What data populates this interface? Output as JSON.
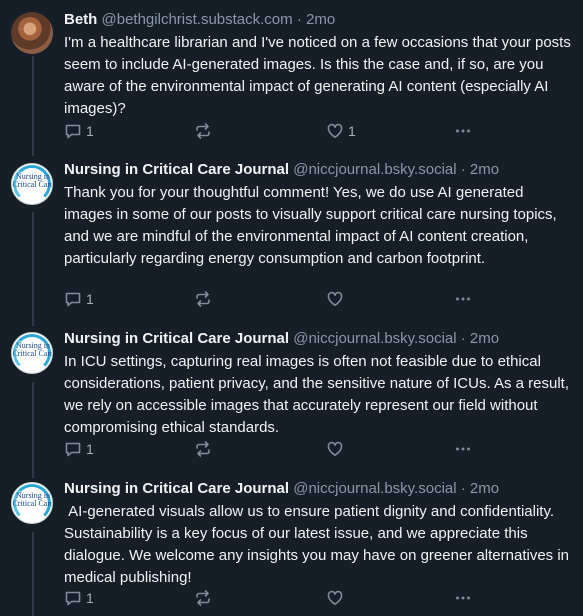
{
  "colors": {
    "background": "#161e27",
    "text": "#f1f3f5",
    "muted": "#8a98a6",
    "rail": "#2e3a47"
  },
  "posts": [
    {
      "author": "Beth",
      "handle": "@bethgilchrist.substack.com",
      "time": "· 2mo",
      "text": "I'm a healthcare librarian and I've noticed on a few occasions that your posts seem to include AI-generated images. Is this the case and, if so, are you aware of the environmental impact of generating AI content (especially AI images)?",
      "replies": "1",
      "likes": "1"
    },
    {
      "author": "Nursing in Critical Care Journal",
      "handle": "@niccjournal.bsky.social",
      "time": "· 2mo",
      "avatar_text": "Nursing in Critical Care",
      "text": "Thank you for your thoughtful comment! Yes, we do use AI generated images in some of our posts to visually support critical care nursing topics, and we are mindful of the environmental impact of AI content creation, particularly regarding energy consumption and carbon footprint.",
      "replies": "1",
      "likes": ""
    },
    {
      "author": "Nursing in Critical Care Journal",
      "handle": "@niccjournal.bsky.social",
      "time": "· 2mo",
      "avatar_text": "Nursing in Critical Care",
      "text": "In ICU settings, capturing real images is often not feasible due to ethical considerations, patient privacy, and the sensitive nature of ICUs. As a result, we rely on accessible images that accurately represent our field without compromising ethical standards.",
      "replies": "1",
      "likes": ""
    },
    {
      "author": "Nursing in Critical Care Journal",
      "handle": "@niccjournal.bsky.social",
      "time": "· 2mo",
      "avatar_text": "Nursing in Critical Care",
      "text": " AI-generated visuals allow us to ensure patient dignity and confidentiality. Sustainability is a key focus of our latest issue, and we appreciate this dialogue. We welcome any insights you may have on greener alternatives in medical publishing!",
      "replies": "1",
      "likes": ""
    }
  ]
}
